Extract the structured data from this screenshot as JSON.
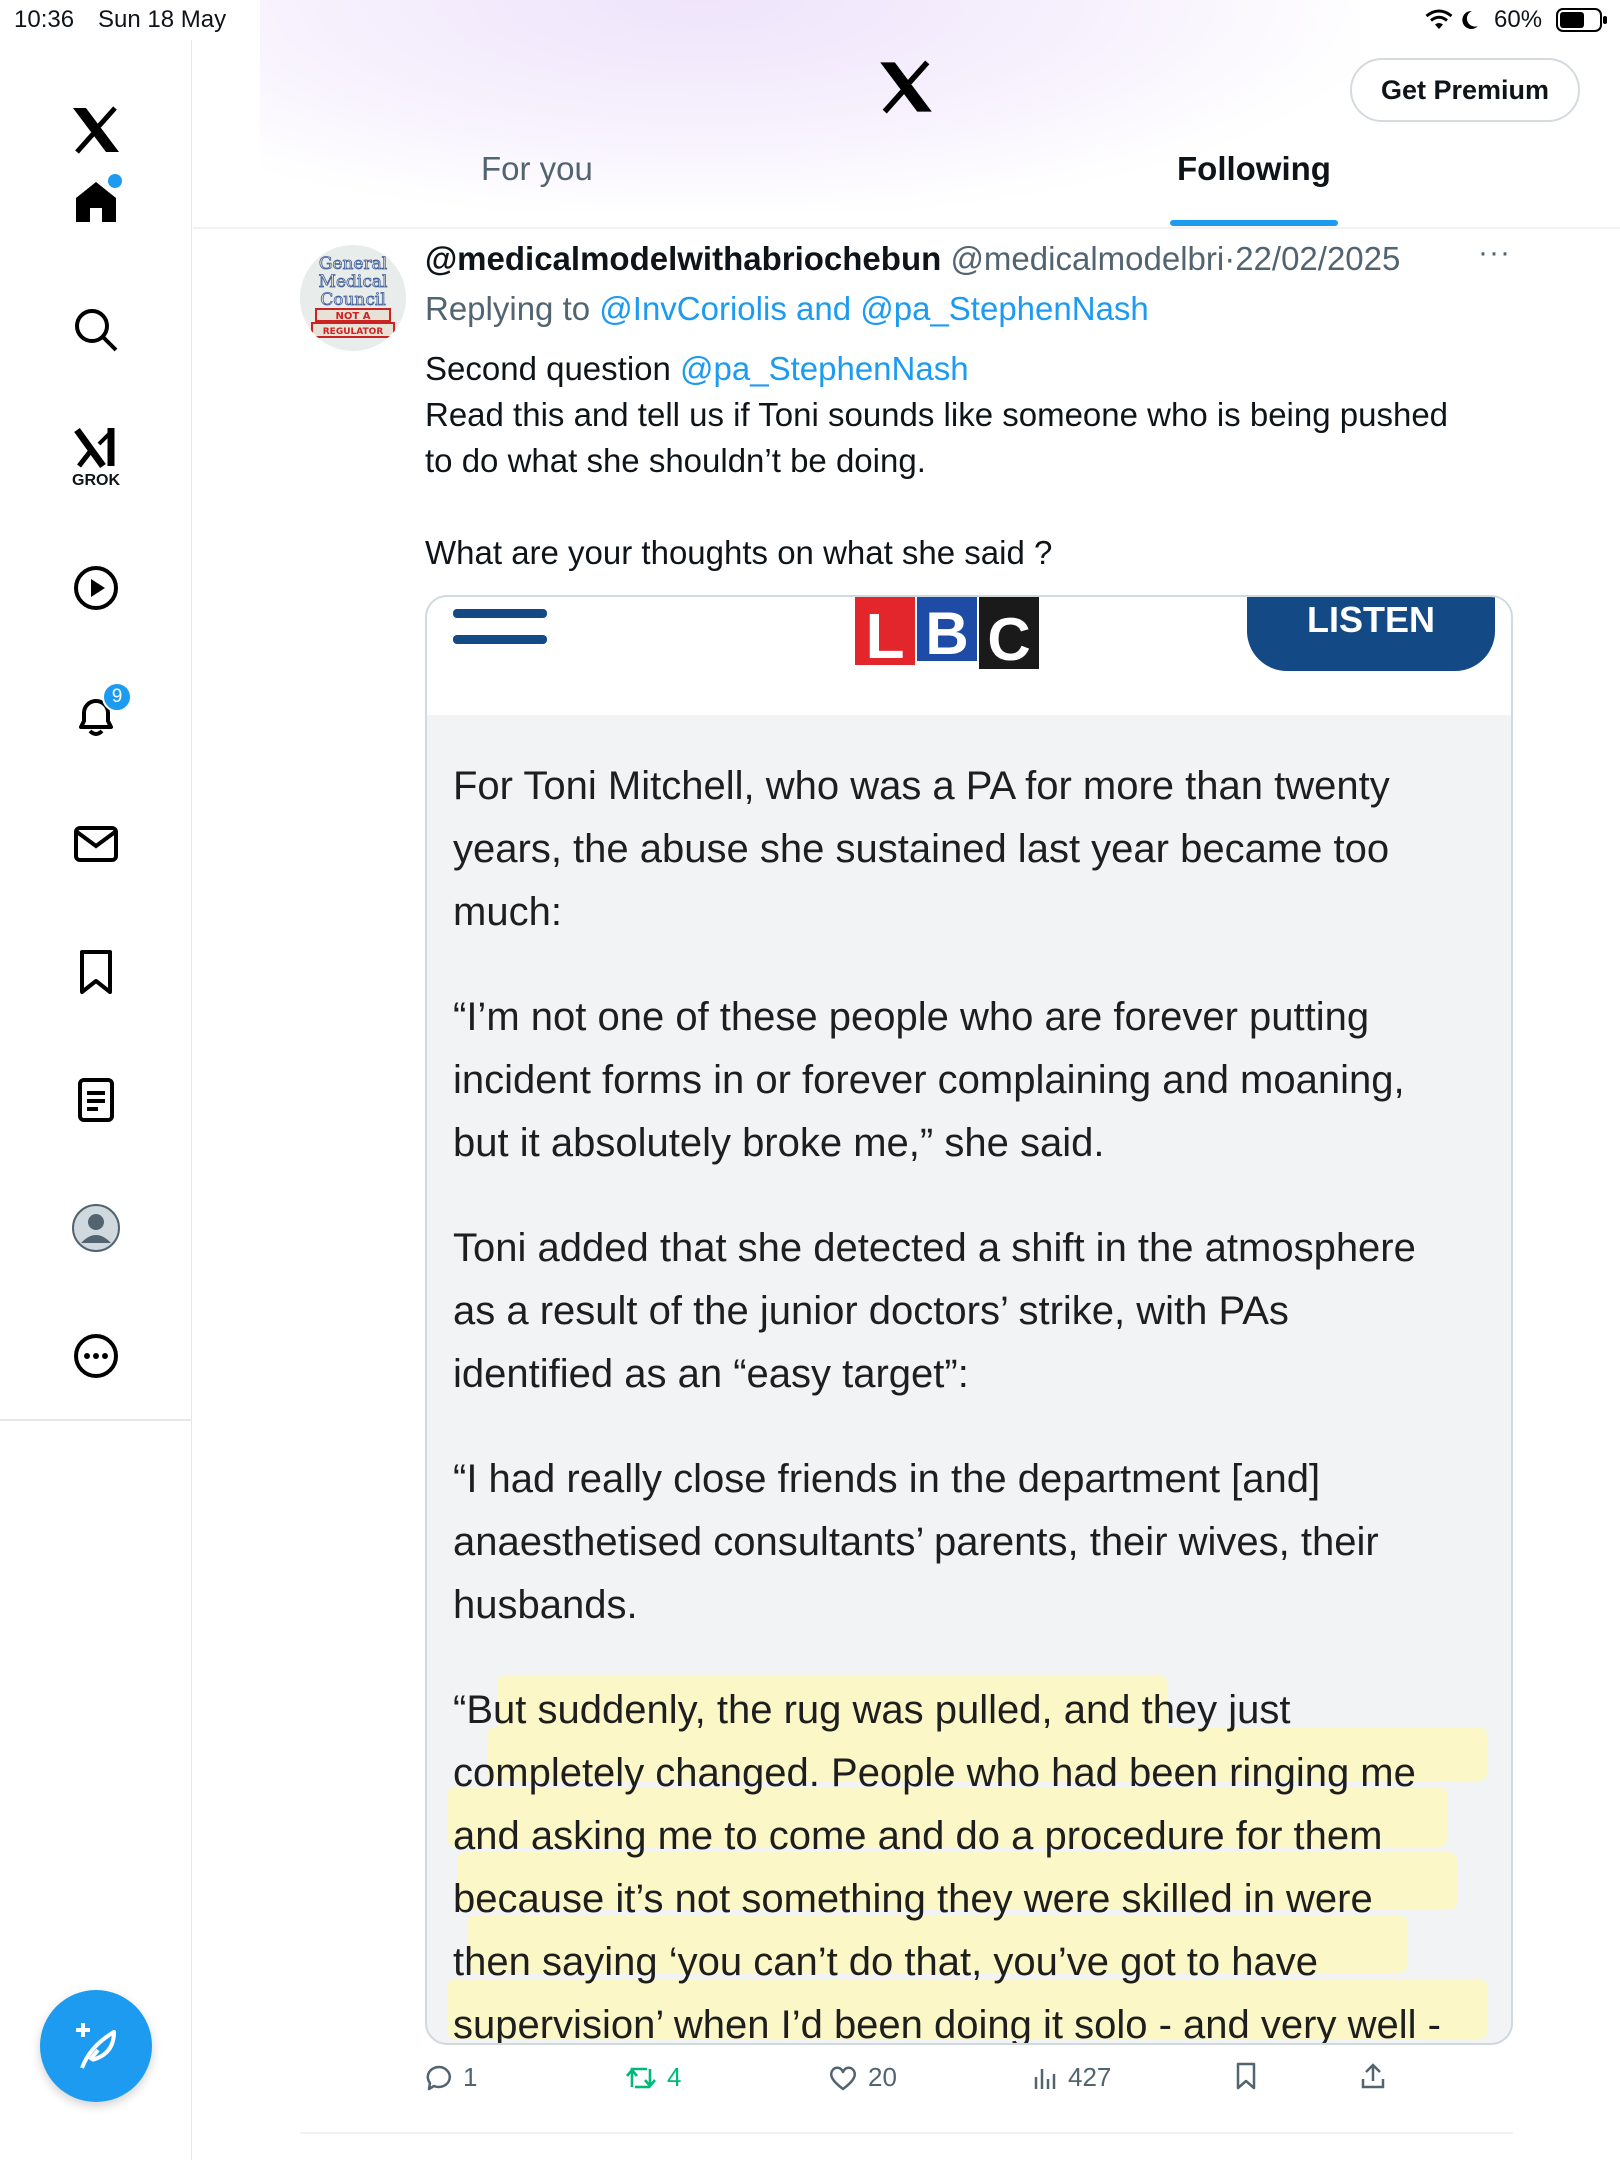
{
  "status_bar": {
    "time": "10:36",
    "date": "Sun 18 May",
    "battery": "60%"
  },
  "header": {
    "get_premium_label": "Get Premium",
    "tabs": [
      {
        "label": "For you",
        "active": false
      },
      {
        "label": "Following",
        "active": true
      }
    ]
  },
  "sidebar": {
    "grok_label": "GROK",
    "notifications_badge": "9",
    "items": [
      "home",
      "search",
      "grok",
      "video",
      "notifications",
      "messages",
      "bookmarks",
      "lists",
      "profile",
      "more"
    ]
  },
  "tweet": {
    "display_name": "@medicalmodelwithabriochebun",
    "handle": "@medicalmodelbri",
    "separator": "·",
    "date": "22/02/2025",
    "replying_prefix": "Replying to",
    "reply_user_1": "@InvCoriolis",
    "reply_and": "and",
    "reply_user_2": "@pa_StephenNash",
    "body_line1_prefix": "Second question",
    "body_line1_mention": "@pa_StephenNash",
    "body_line2": "Read this and tell us if Toni  sounds like someone who is being pushed",
    "body_line3": "to do what she shouldn’t be doing.",
    "body_line4": "What are your thoughts on what she said ?",
    "avatar_text": [
      "General",
      "Medical",
      "Council",
      "NOT A",
      "REGULATOR"
    ],
    "media": {
      "logo_letters": [
        "L",
        "B",
        "C"
      ],
      "listen_label": "LISTEN",
      "paragraphs": [
        [
          "For Toni Mitchell, who was a PA for more than twenty",
          "years, the abuse she sustained last year became too",
          "much:"
        ],
        [
          "“I’m not one of these people who are forever putting",
          "incident forms in or forever complaining and moaning,",
          "but it absolutely broke me,” she said."
        ],
        [
          "Toni added that she detected a shift in the atmosphere",
          "as a result of the junior doctors’ strike, with PAs",
          "identified as an “easy target”:"
        ],
        [
          "“I had really close friends in the department [and]",
          "anaesthetised consultants’ parents, their wives, their",
          "husbands."
        ],
        [
          "“But suddenly, the rug was pulled, and they just",
          "completely changed. People who had been ringing me",
          "and asking me to come and do a procedure for them",
          "because it’s not something they were skilled in were",
          "then saying ‘you can’t do that, you’ve got to have",
          "supervision’ when I’d been doing it solo - and very well -"
        ]
      ]
    },
    "actions": {
      "replies": "1",
      "reposts": "4",
      "likes": "20",
      "views": "427"
    }
  },
  "colors": {
    "accent": "#1d9bf0",
    "repost": "#00ba7c",
    "lbc_red": "#e3262b",
    "lbc_blue": "#1d4ba6",
    "listen_bg": "#134a86",
    "highlight": "#fbf7c6"
  }
}
